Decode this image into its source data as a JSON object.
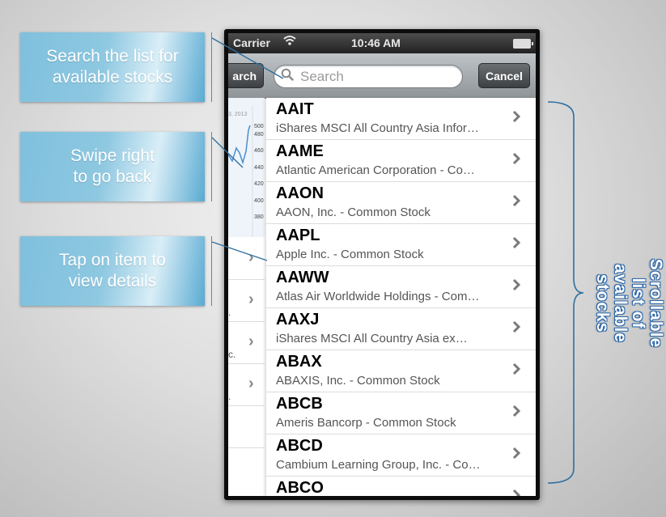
{
  "callouts": {
    "search": "Search the list for\navailable stocks",
    "swipe": "Swipe right\nto go back",
    "tap": "Tap on item to\nview details"
  },
  "side_label": "Scrollable list of\navailable stocks",
  "status_bar": {
    "carrier": "Carrier",
    "time": "10:46 AM"
  },
  "search_bar": {
    "back_label": "arch",
    "placeholder": "Search",
    "cancel_label": "Cancel"
  },
  "previous_view": {
    "chart_header": "3, 2013",
    "y_ticks": [
      "500",
      "480",
      "460",
      "440",
      "420",
      "400",
      "380"
    ],
    "row_fragments": [
      ".",
      "c.",
      "."
    ]
  },
  "stocks": [
    {
      "symbol": "AAIT",
      "name": "iShares MSCI All Country Asia Infor…"
    },
    {
      "symbol": "AAME",
      "name": "Atlantic American Corporation - Co…"
    },
    {
      "symbol": "AAON",
      "name": "AAON, Inc. - Common Stock"
    },
    {
      "symbol": "AAPL",
      "name": "Apple Inc. - Common Stock"
    },
    {
      "symbol": "AAWW",
      "name": "Atlas Air Worldwide Holdings - Com…"
    },
    {
      "symbol": "AAXJ",
      "name": "iShares MSCI All Country Asia ex…"
    },
    {
      "symbol": "ABAX",
      "name": "ABAXIS, Inc. - Common Stock"
    },
    {
      "symbol": "ABCB",
      "name": "Ameris Bancorp - Common Stock"
    },
    {
      "symbol": "ABCD",
      "name": "Cambium Learning Group, Inc. - Co…"
    },
    {
      "symbol": "ABCO",
      "name": ""
    }
  ],
  "colors": {
    "callout_blue": "#8ec8e1",
    "accent_blue": "#2a66a8"
  }
}
